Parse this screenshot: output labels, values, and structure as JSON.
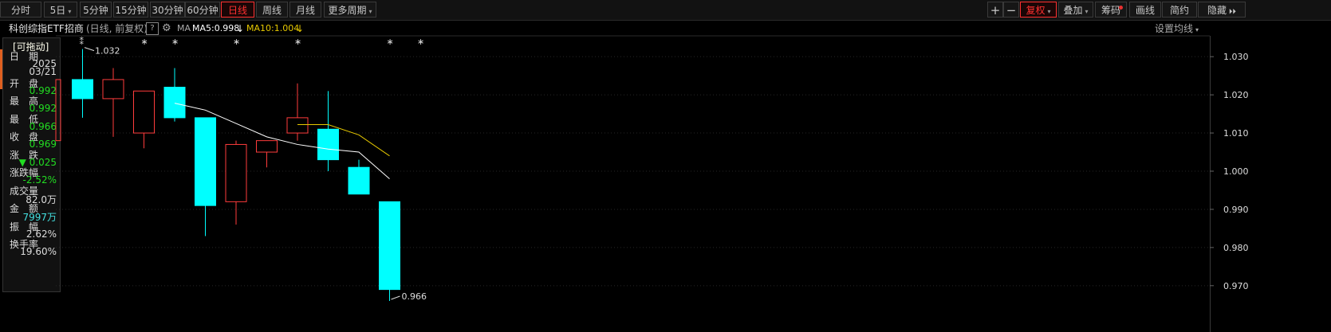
{
  "toolbar": {
    "left_buttons": [
      "分时",
      "5日",
      "5分钟",
      "15分钟",
      "30分钟",
      "60分钟",
      "日线",
      "周线",
      "月线",
      "更多周期"
    ],
    "active_period": "日线",
    "right_buttons": [
      "复权",
      "叠加",
      "筹码",
      "画线",
      "简约",
      "隐藏"
    ],
    "plus_icon": "plus-icon",
    "minus_icon": "minus-icon"
  },
  "header": {
    "name": "科创综指ETF招商",
    "mode": "(日线, 前复权)",
    "help": "?",
    "ma_label": "MA",
    "ma5": "MA5:0.998",
    "ma10": "MA10:1.004",
    "settings": "设置均线"
  },
  "panel": {
    "title": "[可拖动]",
    "rows": [
      {
        "label": "日　期",
        "value": "2025",
        "color": "#ddd"
      },
      {
        "label": "",
        "value": "03/21",
        "color": "#ddd"
      },
      {
        "label": "开　盘",
        "value": "0.992",
        "color": "#22dd22"
      },
      {
        "label": "最　高",
        "value": "0.992",
        "color": "#22dd22"
      },
      {
        "label": "最　低",
        "value": "0.966",
        "color": "#22dd22"
      },
      {
        "label": "收　盘",
        "value": "0.969",
        "color": "#22dd22"
      },
      {
        "label": "涨　跌",
        "value": "▼ 0.025",
        "color": "#22dd22"
      },
      {
        "label": "涨跌幅",
        "value": "-2.52%",
        "color": "#22dd22"
      },
      {
        "label": "成交量",
        "value": "82.0万",
        "color": "#ddd"
      },
      {
        "label": "金　额",
        "value": "7997万",
        "color": "#44e0e0"
      },
      {
        "label": "振　幅",
        "value": "2.62%",
        "color": "#ddd"
      },
      {
        "label": "换手率",
        "value": "19.60%",
        "color": "#ddd"
      }
    ]
  },
  "axis": {
    "ticks": [
      "1.030",
      "1.020",
      "1.010",
      "1.000",
      "0.990",
      "0.980",
      "0.970"
    ]
  },
  "annotations": {
    "high": "1.032",
    "low": "0.966"
  },
  "colors": {
    "up": "#ff3c3c",
    "down": "#00ffff",
    "ma5": "#ffffff",
    "ma10": "#e6c800",
    "active": "#ff3030"
  },
  "chart_data": {
    "type": "candlestick",
    "ylim": [
      0.966,
      1.034
    ],
    "ticks": [
      1.03,
      1.02,
      1.01,
      1.0,
      0.99,
      0.98,
      0.97
    ],
    "candles": [
      {
        "open": 1.01,
        "close": 1.024,
        "high": 1.024,
        "low": 1.008
      },
      {
        "open": 1.024,
        "close": 1.019,
        "high": 1.032,
        "low": 1.014
      },
      {
        "open": 1.019,
        "close": 1.024,
        "high": 1.027,
        "low": 1.009
      },
      {
        "open": 1.01,
        "close": 1.021,
        "high": 1.021,
        "low": 1.006
      },
      {
        "open": 1.022,
        "close": 1.014,
        "high": 1.027,
        "low": 1.013
      },
      {
        "open": 1.014,
        "close": 0.991,
        "high": 1.014,
        "low": 0.983
      },
      {
        "open": 0.992,
        "close": 1.007,
        "high": 1.008,
        "low": 0.986
      },
      {
        "open": 1.005,
        "close": 1.008,
        "high": 1.008,
        "low": 1.001
      },
      {
        "open": 1.01,
        "close": 1.014,
        "high": 1.023,
        "low": 1.008
      },
      {
        "open": 1.011,
        "close": 1.003,
        "high": 1.021,
        "low": 1.0
      },
      {
        "open": 1.001,
        "close": 0.994,
        "high": 1.003,
        "low": 0.994
      },
      {
        "open": 0.992,
        "close": 0.969,
        "high": 0.992,
        "low": 0.966
      }
    ],
    "ma5": [
      null,
      null,
      null,
      null,
      1.0178,
      1.016,
      1.0125,
      1.009,
      1.007,
      1.0058,
      1.005,
      0.998
    ],
    "ma10": [
      null,
      null,
      null,
      null,
      null,
      null,
      null,
      null,
      1.0122,
      1.0122,
      1.0095,
      1.004
    ],
    "markers": [
      0,
      2,
      3,
      5,
      7,
      10,
      11
    ]
  }
}
